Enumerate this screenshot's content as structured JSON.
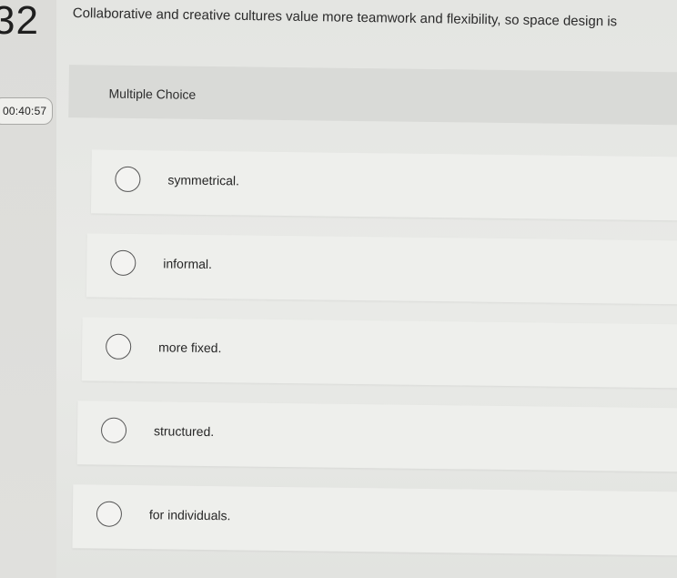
{
  "question": {
    "number": "32",
    "timer": "00:40:57",
    "text": "Collaborative and creative cultures value more teamwork and flexibility, so space design is",
    "type_label": "Multiple Choice"
  },
  "options": [
    {
      "label": "symmetrical."
    },
    {
      "label": "informal."
    },
    {
      "label": "more fixed."
    },
    {
      "label": "structured."
    },
    {
      "label": "for individuals."
    }
  ]
}
